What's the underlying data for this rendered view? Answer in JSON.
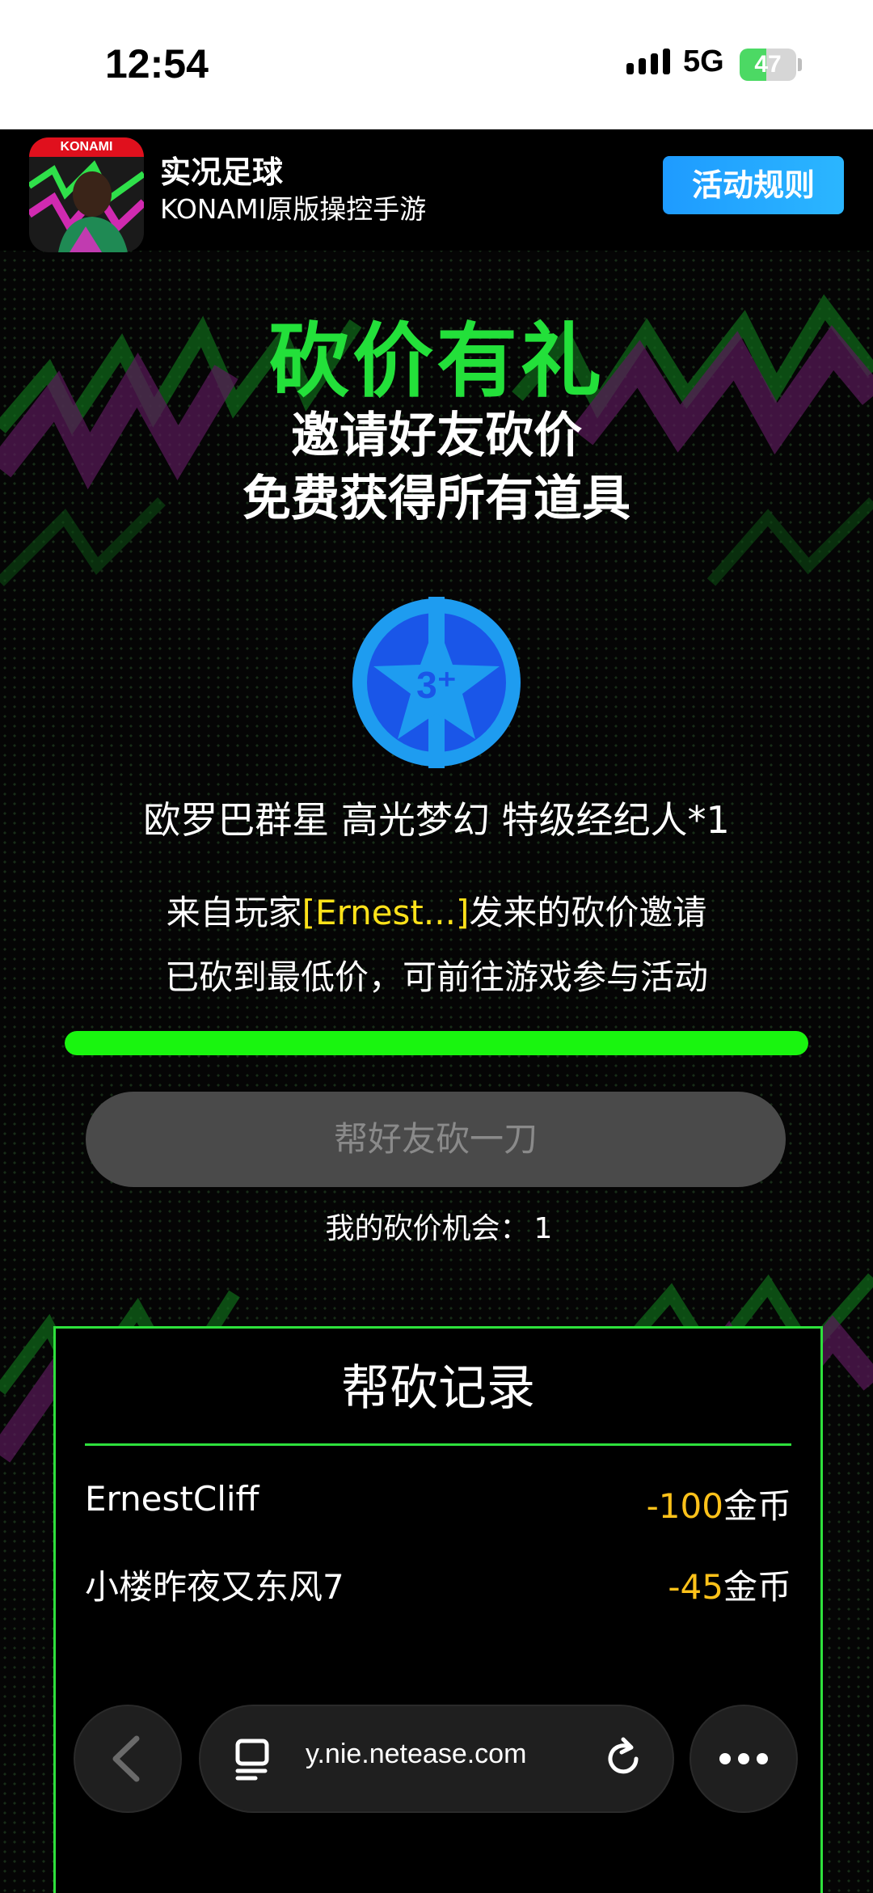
{
  "status": {
    "time": "12:54",
    "network": "5G",
    "battery": "47",
    "battery_level": 0.47
  },
  "app": {
    "konami": "KONAMI",
    "name": "实况足球",
    "subtitle": "KONAMI原版操控手游",
    "rules_button": "活动规则"
  },
  "hero": {
    "title": "砍价有礼",
    "line1": "邀请好友砍价",
    "line2": "免费获得所有道具"
  },
  "reward": {
    "badge_text": "3⁺",
    "name": "欧罗巴群星 高光梦幻 特级经纪人*1"
  },
  "invite": {
    "prefix": "来自玩家",
    "player": "[Ernest...]",
    "suffix": "发来的砍价邀请",
    "status": "已砍到最低价，可前往游戏参与活动"
  },
  "progress": {
    "value": 1.0
  },
  "action": {
    "cut_button": "帮好友砍一刀",
    "chances_label": "我的砍价机会：",
    "chances_value": "1"
  },
  "records": {
    "title": "帮砍记录",
    "rows": [
      {
        "name": "ErnestCliff",
        "amount": "-100",
        "unit": "金币"
      },
      {
        "name": "小楼昨夜又东风7",
        "amount": "-45",
        "unit": "金币"
      }
    ]
  },
  "browser": {
    "url": "y.nie.netease.com"
  },
  "colors": {
    "accent_green": "#23e03a",
    "highlight_yellow": "#ffe21a",
    "rules_blue": "#1e9bff"
  }
}
